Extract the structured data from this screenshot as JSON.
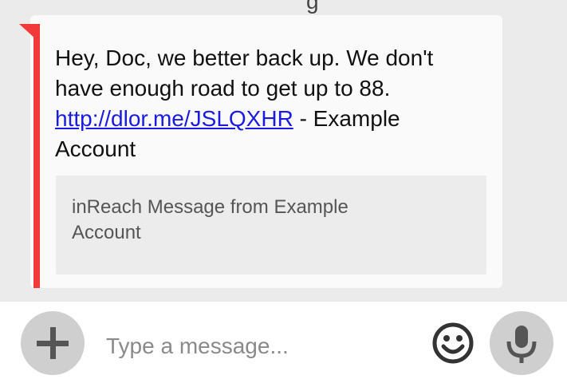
{
  "conversation": {
    "message": {
      "text_before_link": "Hey, Doc, we better back up. We don't have enough road to get up to 88. ",
      "link_text": "http://dlor.me/JSLQXHR",
      "text_after_link": " - Example Account",
      "attachment_text": "inReach Message from Example Account"
    },
    "colors": {
      "accent": "#f23a3a",
      "link": "#1a1ae0",
      "background": "#ebebeb",
      "bubble": "#fafafa"
    }
  },
  "composer": {
    "placeholder": "Type a message...",
    "icons": {
      "add": "plus-icon",
      "emoji": "smiley-icon",
      "voice": "microphone-icon"
    }
  }
}
